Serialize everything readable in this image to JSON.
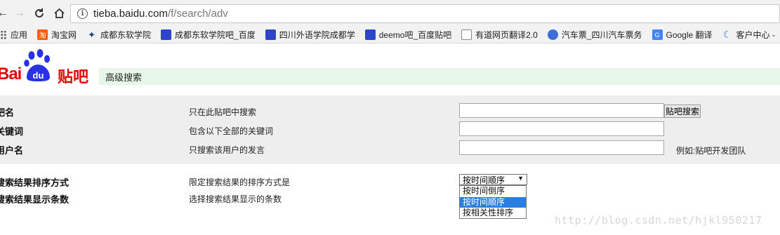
{
  "browser": {
    "url_host": "tieba.baidu.com",
    "url_path": "/f/search/adv",
    "nav": {
      "back": "←",
      "forward": "→",
      "reload": "C",
      "home": "⌂"
    },
    "info_icon": "i"
  },
  "bookmarks": [
    {
      "label": "应用",
      "icon": "apps-icon"
    },
    {
      "label": "淘宝网",
      "icon": "taobao-icon",
      "glyph": "淘"
    },
    {
      "label": "成都东软学院",
      "icon": "neusoft-icon",
      "glyph": "✦"
    },
    {
      "label": "成都东软学院吧_百度",
      "icon": "baidu-paw-icon"
    },
    {
      "label": "四川外语学院成都学",
      "icon": "baidu-paw-icon"
    },
    {
      "label": "deemo吧_百度贴吧",
      "icon": "baidu-paw-icon"
    },
    {
      "label": "有道网页翻译2.0",
      "icon": "document-icon"
    },
    {
      "label": "汽车票_四川汽车票务",
      "icon": "bus-icon"
    },
    {
      "label": "Google 翻译",
      "icon": "google-translate-icon",
      "glyph": "G"
    },
    {
      "label": "客户中心 -",
      "icon": "moon-icon",
      "glyph": "☾"
    }
  ],
  "logo": {
    "bai": "Bai",
    "du": "du",
    "tieba": "贴吧"
  },
  "page_title": "高级搜索",
  "rows": [
    {
      "label": "吧名",
      "desc": "只在此贴吧中搜索",
      "value": ""
    },
    {
      "label": "关键词",
      "desc": "包含以下全部的关键词",
      "value": ""
    },
    {
      "label": "用户名",
      "desc": "只搜索该用户的发言",
      "value": ""
    }
  ],
  "search_button": "贴吧搜索",
  "example_text": "例如:贴吧开发团队",
  "sort": {
    "label": "搜索结果排序方式",
    "desc": "限定搜索结果的排序方式是",
    "selected": "按时间顺序",
    "arrow": "▼",
    "options": [
      "按时间倒序",
      "按时间顺序",
      "按相关性排序"
    ],
    "highlighted_index": 1
  },
  "count": {
    "label": "搜索结果显示条数",
    "desc": "选择搜索结果显示的条数"
  },
  "watermark": "http://blog.csdn.net/hjkl950217",
  "colors": {
    "accent": "#2a7de1",
    "brand_red": "#e10602",
    "title_bg": "#e6f7ea"
  }
}
